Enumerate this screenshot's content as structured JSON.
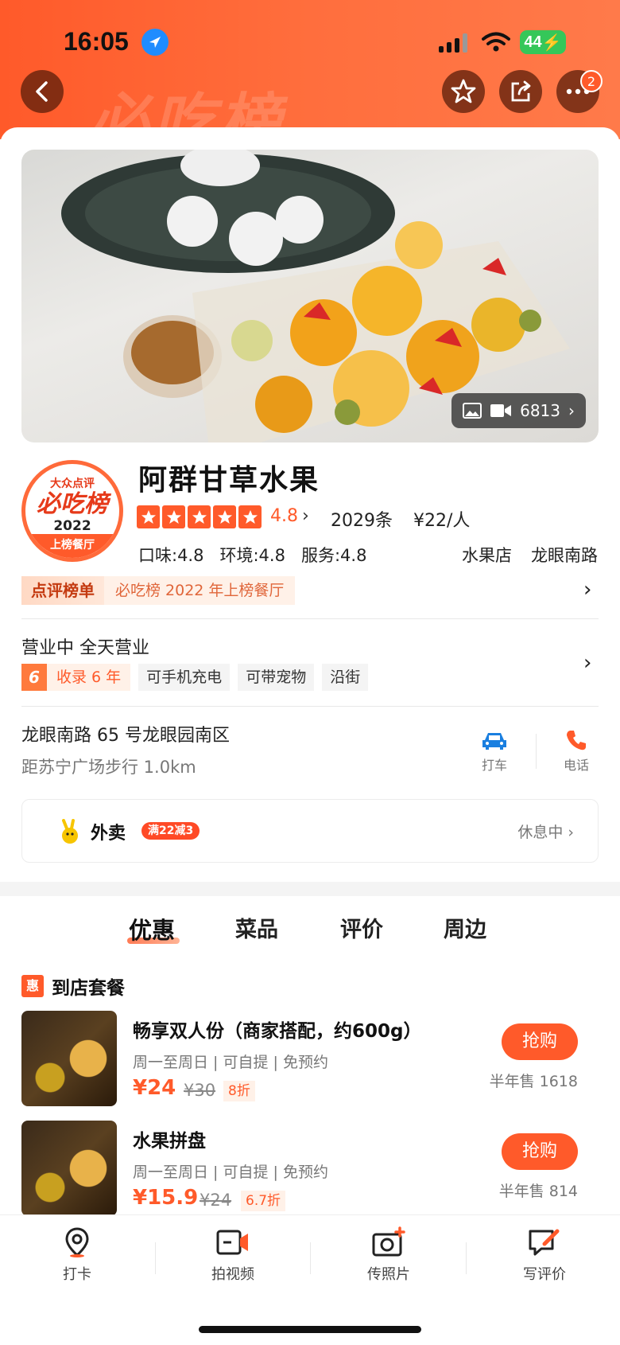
{
  "status_bar": {
    "time": "16:05",
    "battery": "44"
  },
  "header": {
    "watermark": "必吃榜",
    "notification_count": "2"
  },
  "hero": {
    "media_count": "6813"
  },
  "shop": {
    "logo": {
      "line1": "大众点评",
      "line2": "必吃榜",
      "year": "2022",
      "ribbon": "上榜餐厅"
    },
    "name": "阿群甘草水果",
    "rating": "4.8",
    "rating_stars": 5,
    "review_count": "2029条",
    "avg_price": "¥22/人",
    "scores": [
      "口味:4.8",
      "环境:4.8",
      "服务:4.8"
    ],
    "category": "水果店",
    "area": "龙眼南路",
    "rank_tag": "点评榜单",
    "rank_text": "必吃榜 2022 年上榜餐厅"
  },
  "info": {
    "hours": "营业中 全天营业",
    "years_num": "6",
    "years_text": "收录 6 年",
    "tags": [
      "可手机充电",
      "可带宠物",
      "沿街"
    ],
    "address": "龙眼南路 65 号龙眼园南区",
    "distance": "距苏宁广场步行 1.0km",
    "taxi_label": "打车",
    "phone_label": "电话"
  },
  "delivery": {
    "name": "外卖",
    "promo": "满22减3",
    "status": "休息中"
  },
  "tabs": [
    "优惠",
    "菜品",
    "评价",
    "周边"
  ],
  "section": {
    "icon": "惠",
    "title": "到店套餐"
  },
  "deals": [
    {
      "title": "畅享双人份（商家搭配，约600g）",
      "sub": "周一至周日 | 可自提 | 免预约",
      "price": "¥24",
      "old_price": "¥30",
      "discount": "8折",
      "button": "抢购",
      "sold": "半年售 1618"
    },
    {
      "title": "水果拼盘",
      "sub": "周一至周日 | 可自提 | 免预约",
      "price": "¥15.9",
      "old_price": "¥24",
      "discount": "6.7折",
      "button": "抢购",
      "sold": "半年售 814"
    }
  ],
  "bottom_nav": [
    "打卡",
    "拍视频",
    "传照片",
    "写评价"
  ],
  "colors": {
    "accent": "#ff5a2a",
    "battery": "#35c759"
  }
}
